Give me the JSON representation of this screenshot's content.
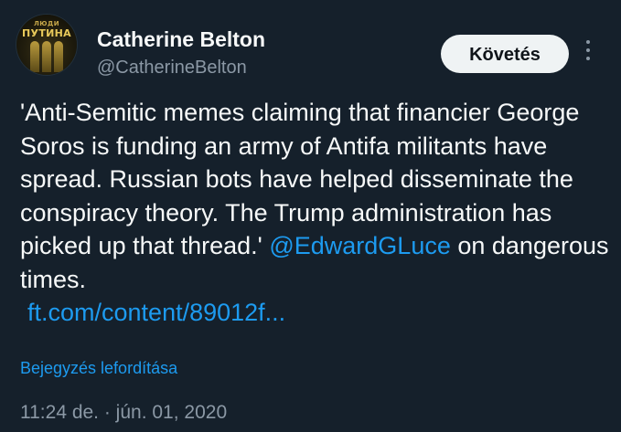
{
  "author": {
    "avatar_text_top": "ЛЮДИ",
    "avatar_text_main": "ПУТИНА",
    "name": "Catherine Belton",
    "handle": "@CatherineBelton"
  },
  "actions": {
    "follow_label": "Követés",
    "more_icon": "more-vertical-icon"
  },
  "tweet": {
    "text_part1": "'Anti-Semitic memes claiming that financier George Soros is funding an army of Antifa militants have spread. Russian bots have helped disseminate the conspiracy theory. The Trump administration has picked up that thread.' ",
    "mention": "@EdwardGLuce",
    "text_part2": " on dangerous times.",
    "link": "ft.com/content/89012f..."
  },
  "translate_label": "Bejegyzés lefordítása",
  "timestamp": "11:24 de. · jún. 01, 2020",
  "colors": {
    "background": "#15202b",
    "text": "#f7f9f9",
    "secondary": "#8b98a5",
    "accent": "#1d9bf0",
    "button_bg": "#eff3f4"
  }
}
